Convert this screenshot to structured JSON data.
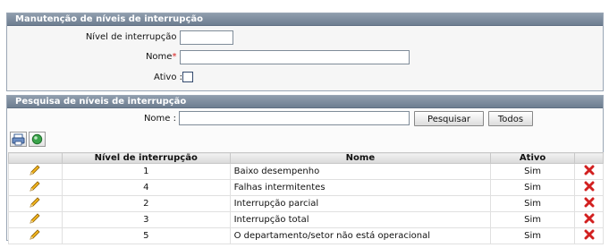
{
  "form_panel": {
    "title": "Manutenção de níveis de interrupção",
    "nivel_label": "Nível de interrupção :",
    "nome_label": "Nome",
    "nome_required": "*",
    "nome_colon": " :",
    "ativo_label": "Ativo :",
    "nivel_value": "",
    "nome_value": "",
    "ativo_checked": false
  },
  "search_panel": {
    "title": "Pesquisa de níveis de interrupção",
    "nome_label": "Nome :",
    "nome_value": "",
    "search_button": "Pesquisar",
    "all_button": "Todos"
  },
  "toolbar": {
    "icons": [
      "print-icon",
      "refresh-icon"
    ]
  },
  "table": {
    "columns": [
      "",
      "Nível de interrupção",
      "Nome",
      "Ativo",
      ""
    ],
    "rows": [
      {
        "nivel": "1",
        "nome": "Baixo desempenho",
        "ativo": "Sim"
      },
      {
        "nivel": "4",
        "nome": "Falhas intermitentes",
        "ativo": "Sim"
      },
      {
        "nivel": "2",
        "nome": "Interrupção parcial",
        "ativo": "Sim"
      },
      {
        "nivel": "3",
        "nome": "Interrupção total",
        "ativo": "Sim"
      },
      {
        "nivel": "5",
        "nome": "O departamento/setor não está operacional",
        "ativo": "Sim"
      }
    ]
  },
  "colors": {
    "header_bar": "#7b8a9c",
    "required_star": "#d81b1b",
    "delete_icon": "#d22020",
    "edit_icon": "#e8a317"
  }
}
